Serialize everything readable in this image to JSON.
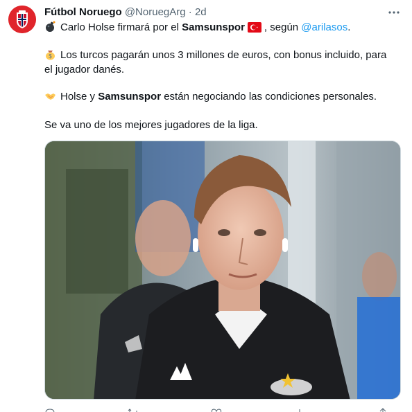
{
  "tweet": {
    "author": {
      "name": "Fútbol Noruego",
      "handle": "@NoruegArg",
      "separator": "·",
      "time": "2d"
    },
    "lines": {
      "l1": {
        "emoji": "bomb-emoji",
        "text_a": "Carlo Holse firmará por el ",
        "bold": "Samsunspor",
        "flag": "turkey-flag",
        "text_b": ", según ",
        "mention": "@arilasos",
        "text_c": "."
      },
      "l2": {
        "emoji": "money-bag-emoji",
        "text": "Los turcos pagarán unos 3 millones de euros, con bonus incluido, para"
      },
      "l3": {
        "text": "el jugador danés."
      },
      "l4": {
        "emoji": "handshake-emoji",
        "text_a": "Holse y ",
        "bold": "Samsunspor",
        "text_b": " están negociando las condiciones personales."
      },
      "l5": {
        "text": "Se va uno de los mejores jugadores de la liga."
      }
    },
    "media": {
      "description_icon": "photo-football-player"
    },
    "colors": {
      "accent": "#1d9bf0",
      "text": "#0f1419",
      "muted": "#536471",
      "avatar_bg": "#e0252b"
    }
  }
}
